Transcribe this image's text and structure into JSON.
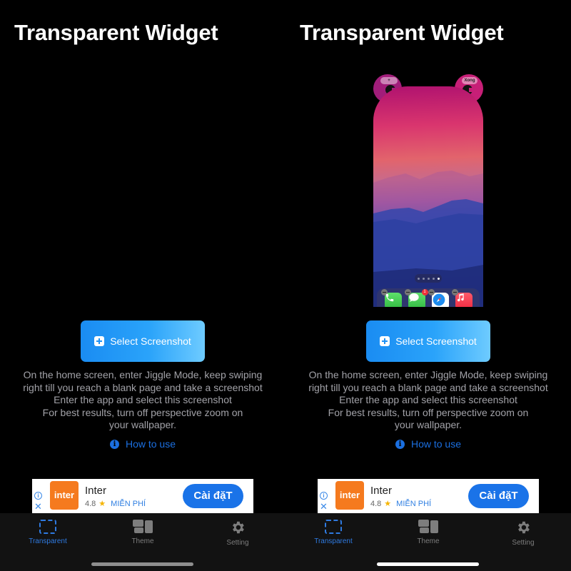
{
  "panels": [
    {
      "title": "Transparent Widget",
      "has_preview": false,
      "select_button": {
        "label": "Select Screenshot"
      },
      "instructions": [
        "On the home screen, enter Jiggle Mode, keep swiping",
        "right till you reach a blank page and take a screenshot",
        "Enter the app and select this screenshot",
        "For best results, turn off perspective zoom on",
        "your wallpaper."
      ],
      "how_to_use": {
        "label": "How to use",
        "icon": "info-icon"
      },
      "ad": {
        "logo_text": "inter",
        "name": "Inter",
        "rating": "4.8",
        "price": "MIỄN PHÍ",
        "install_label": "Cài đặT",
        "info_icon": "ⓘ",
        "close_icon": "✕"
      },
      "tabs": [
        {
          "label": "Transparent",
          "icon": "transparent-icon",
          "active": true
        },
        {
          "label": "Theme",
          "icon": "theme-icon",
          "active": false
        },
        {
          "label": "Setting",
          "icon": "gear-icon",
          "active": false
        }
      ],
      "home_indicator_color": "#8e8e8e"
    },
    {
      "title": "Transparent Widget",
      "has_preview": true,
      "preview": {
        "left_ear_button": "+",
        "right_ear_button": "Xong",
        "page_dots": 5,
        "active_page_dot": 5,
        "dock_apps": [
          {
            "name": "Phone",
            "badge": ""
          },
          {
            "name": "Messages",
            "badge": "1"
          },
          {
            "name": "Safari",
            "badge": ""
          },
          {
            "name": "Music",
            "badge": ""
          }
        ]
      },
      "select_button": {
        "label": "Select Screenshot"
      },
      "instructions": [
        "On the home screen, enter Jiggle Mode, keep swiping",
        "right till you reach a blank page and take a screenshot",
        "Enter the app and select this screenshot",
        "For best results, turn off perspective zoom on",
        "your wallpaper."
      ],
      "how_to_use": {
        "label": "How to use",
        "icon": "info-icon"
      },
      "ad": {
        "logo_text": "inter",
        "name": "Inter",
        "rating": "4.8",
        "price": "MIỄN PHÍ",
        "install_label": "Cài đặT",
        "info_icon": "ⓘ",
        "close_icon": "✕"
      },
      "tabs": [
        {
          "label": "Transparent",
          "icon": "transparent-icon",
          "active": true
        },
        {
          "label": "Theme",
          "icon": "theme-icon",
          "active": false
        },
        {
          "label": "Setting",
          "icon": "gear-icon",
          "active": false
        }
      ],
      "home_indicator_color": "#ffffff"
    }
  ],
  "colors": {
    "accent": "#2f7ae0",
    "link": "#1b6fe0",
    "install_button": "#1a73e8",
    "ad_logo": "#f57a1e"
  }
}
